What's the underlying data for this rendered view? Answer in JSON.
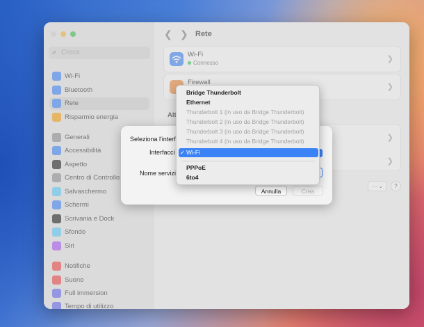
{
  "window": {
    "title": "Rete"
  },
  "sidebar": {
    "search_placeholder": "Cerca",
    "items": [
      {
        "label": "Wi-Fi",
        "icon": "wifi-icon",
        "color": "#3b82f6"
      },
      {
        "label": "Bluetooth",
        "icon": "bluetooth-icon",
        "color": "#3b82f6"
      },
      {
        "label": "Rete",
        "icon": "globe-icon",
        "color": "#3b82f6",
        "selected": true
      },
      {
        "label": "Risparmio energia",
        "icon": "battery-icon",
        "color": "#f59e0b"
      },
      {
        "label": "Generali",
        "icon": "gear-icon",
        "color": "#8e8e93"
      },
      {
        "label": "Accessibilità",
        "icon": "accessibility-icon",
        "color": "#3b82f6"
      },
      {
        "label": "Aspetto",
        "icon": "appearance-icon",
        "color": "#1c1c1e"
      },
      {
        "label": "Centro di Controllo",
        "icon": "control-center-icon",
        "color": "#8e8e93"
      },
      {
        "label": "Salvaschermo",
        "icon": "screensaver-icon",
        "color": "#5ac8fa"
      },
      {
        "label": "Schermi",
        "icon": "display-icon",
        "color": "#3b82f6"
      },
      {
        "label": "Scrivania e Dock",
        "icon": "dock-icon",
        "color": "#1c1c1e"
      },
      {
        "label": "Sfondo",
        "icon": "wallpaper-icon",
        "color": "#5ac8fa"
      },
      {
        "label": "Siri",
        "icon": "siri-icon",
        "color": "#a855f7"
      },
      {
        "label": "Notifiche",
        "icon": "bell-icon",
        "color": "#ef4444"
      },
      {
        "label": "Suono",
        "icon": "speaker-icon",
        "color": "#ef4444"
      },
      {
        "label": "Full immersion",
        "icon": "moon-icon",
        "color": "#6366f1"
      },
      {
        "label": "Tempo di utilizzo",
        "icon": "hourglass-icon",
        "color": "#6366f1"
      }
    ]
  },
  "main": {
    "wifi": {
      "title": "Wi-Fi",
      "status": "Connesso",
      "status_color": "#34c759"
    },
    "firewall": {
      "title": "Firewall"
    },
    "section_partial": "Alt",
    "more_button": "··· ⌄",
    "help_button": "?"
  },
  "dialog": {
    "title": "Seleziona l'interf",
    "interface_label": "Interfacci",
    "name_label": "Nome servizi",
    "cancel": "Annulla",
    "create": "Crea"
  },
  "menu": {
    "items": [
      {
        "label": "Bridge Thunderbolt",
        "enabled": true
      },
      {
        "label": "Ethernet",
        "enabled": true
      },
      {
        "label": "Thunderbolt 1 (in uso da Bridge Thunderbolt)",
        "enabled": false
      },
      {
        "label": "Thunderbolt 2 (in uso da Bridge Thunderbolt)",
        "enabled": false
      },
      {
        "label": "Thunderbolt 3 (in uso da Bridge Thunderbolt)",
        "enabled": false
      },
      {
        "label": "Thunderbolt 4 (in uso da Bridge Thunderbolt)",
        "enabled": false
      },
      {
        "label": "Wi-Fi",
        "enabled": true,
        "selected": true,
        "check": "✓"
      },
      {
        "label": "PPPoE",
        "enabled": true
      },
      {
        "label": "6to4",
        "enabled": true
      }
    ]
  },
  "colors": {
    "accent": "#3b82f6",
    "close": "#ff5f57",
    "minimize": "#febc2e",
    "zoom": "#28c840"
  }
}
